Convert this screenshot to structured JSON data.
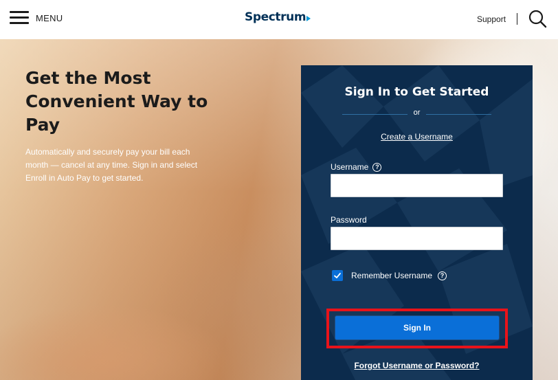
{
  "header": {
    "menu_label": "MENU",
    "logo_text": "Spectrum",
    "support_label": "Support",
    "divider": "|"
  },
  "hero": {
    "title": "Get the Most Convenient Way to Pay",
    "subtitle": "Automatically and securely pay your bill each month — cancel at any time. Sign in and select Enroll in Auto Pay to get started."
  },
  "signin": {
    "title": "Sign In to Get Started",
    "or": "or",
    "create_link": "Create a Username",
    "username_label": "Username",
    "username_value": "",
    "password_label": "Password",
    "password_value": "",
    "remember_label": "Remember Username",
    "remember_checked": true,
    "button_label": "Sign In",
    "forgot_link": "Forgot Username or Password?"
  },
  "icons": {
    "menu": "hamburger-icon",
    "search": "search-icon",
    "help": "question-circle-icon",
    "check": "checkmark-icon"
  },
  "colors": {
    "panel_bg": "#0c2b4c",
    "brand_blue": "#003057",
    "button_blue": "#0a6fd8",
    "highlight_red": "#e8131a"
  }
}
